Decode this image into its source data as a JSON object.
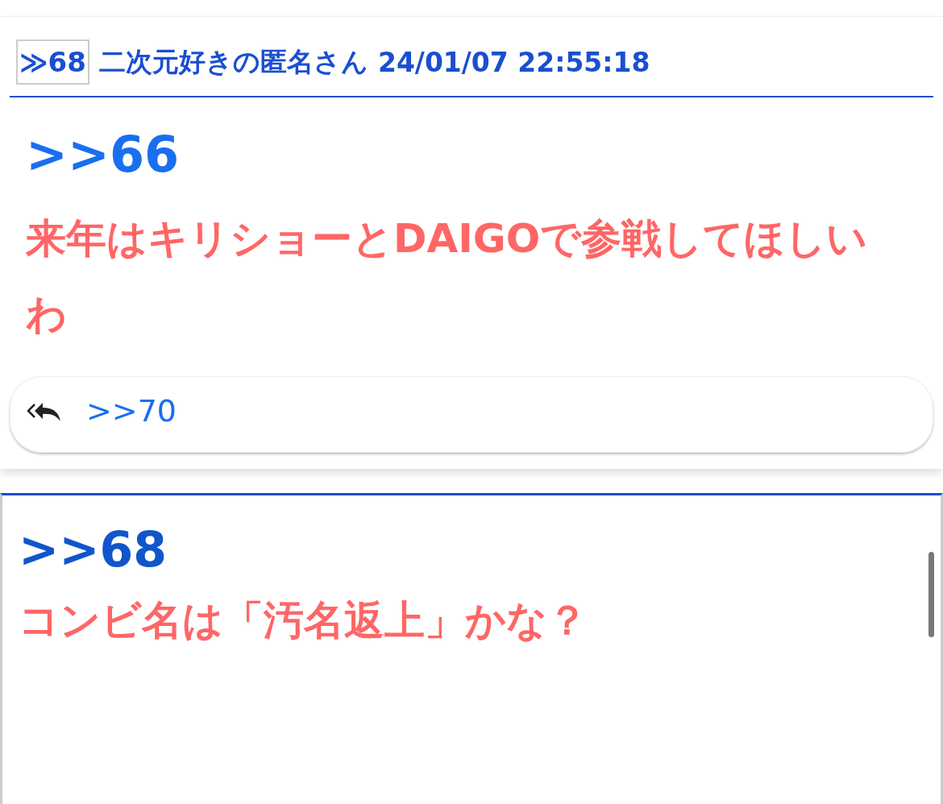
{
  "popup": {
    "header": {
      "anchor": "≫68",
      "author": "二次元好きの匿名さん",
      "date": "24/01/07 22:55:18"
    },
    "reply_ref": ">>66",
    "body": "来年はキリショーとDAIGOで参戦してほしいわ",
    "reply_bar": {
      "link": ">>70"
    }
  },
  "post": {
    "reply_ref": ">>68",
    "body": "コンビ名は「汚名返上」かな？"
  }
}
